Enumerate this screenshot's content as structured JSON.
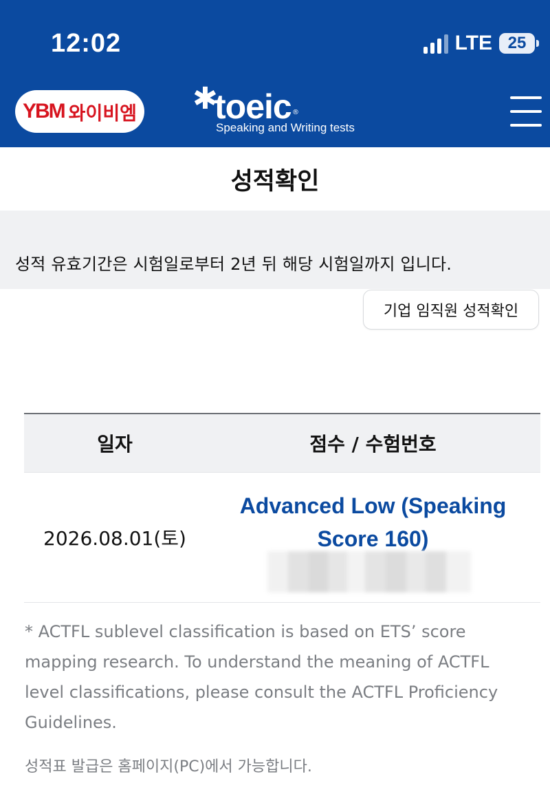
{
  "status_bar": {
    "time": "12:02",
    "network": "LTE",
    "battery": "25",
    "icons": [
      "signal-icon",
      "battery-icon"
    ]
  },
  "header": {
    "ybm_logo_mark": "YBM",
    "ybm_logo_text": "와이비엠",
    "toeic_word": "toeic",
    "toeic_subtitle": "Speaking and Writing tests",
    "menu_icon": "hamburger-menu-icon",
    "background_color": "#0b4aa0"
  },
  "page": {
    "title": "성적확인"
  },
  "notice": {
    "text": "성적 유효기간은 시험일로부터 2년 뒤 해당 시험일까지 입니다."
  },
  "corp_button": {
    "label": "기업 임직원 성적확인"
  },
  "table": {
    "headers": {
      "date": "일자",
      "score": "점수 / 수험번호"
    },
    "rows": [
      {
        "date": "2026.08.01(토)",
        "score_line1": "Advanced Low (Speaking",
        "score_line2": "Score 160)",
        "exam_number": "blurred"
      }
    ]
  },
  "footnote": "* ACTFL sublevel classification is based on ETS’ score mapping research. To understand the meaning of ACTFL level classifications, please consult the ACTFL Proficiency Guidelines.",
  "issue_note": "성적표 발급은 홈페이지(PC)에서 가능합니다.",
  "colors": {
    "accent": "#0b4aa0",
    "ybm_red": "#d7141f",
    "muted_text": "#7a7d82",
    "panel_bg": "#f0f1f3"
  }
}
